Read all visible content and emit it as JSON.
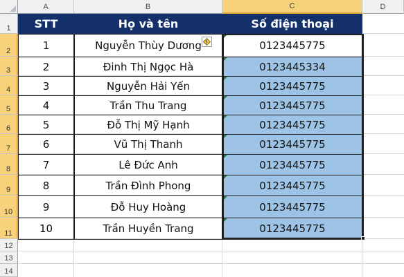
{
  "columns": [
    "A",
    "B",
    "C",
    "D"
  ],
  "rows": [
    "1",
    "2",
    "3",
    "4",
    "5",
    "6",
    "7",
    "8",
    "9",
    "10",
    "11",
    "12",
    "13",
    "14"
  ],
  "table": {
    "headers": {
      "stt": "STT",
      "name": "Họ và tên",
      "phone": "Số điện thoại"
    },
    "records": [
      {
        "stt": "1",
        "name": "Nguyễn Thùy Dương",
        "phone": "0123445775"
      },
      {
        "stt": "2",
        "name": "Đinh Thị Ngọc Hà",
        "phone": "0123445334"
      },
      {
        "stt": "3",
        "name": "Nguyễn Hải Yến",
        "phone": "0123445775"
      },
      {
        "stt": "4",
        "name": "Trần Thu Trang",
        "phone": "0123445775"
      },
      {
        "stt": "5",
        "name": "Đỗ Thị Mỹ Hạnh",
        "phone": "0123445775"
      },
      {
        "stt": "6",
        "name": "Vũ Thị Thanh",
        "phone": "0123445775"
      },
      {
        "stt": "7",
        "name": "Lê Đức Anh",
        "phone": "0123445775"
      },
      {
        "stt": "8",
        "name": "Trần Đình Phong",
        "phone": "0123445775"
      },
      {
        "stt": "9",
        "name": "Đỗ Huy Hoàng",
        "phone": "0123445775"
      },
      {
        "stt": "10",
        "name": "Trần Huyền Trang",
        "phone": "0123445775"
      }
    ]
  },
  "selection": {
    "range": "C2:C11",
    "selected_column": "C",
    "active_cell": "C2"
  },
  "icons": {
    "error_indicator": "warning-diamond-icon",
    "number_as_text_marker": "green-triangle"
  },
  "colors": {
    "header_fill": "#13306a",
    "header_text": "#ffffff",
    "selection_fill": "#9dc3e6",
    "selected_header": "#f7d27a",
    "error_marker": "#1f7a3a"
  }
}
